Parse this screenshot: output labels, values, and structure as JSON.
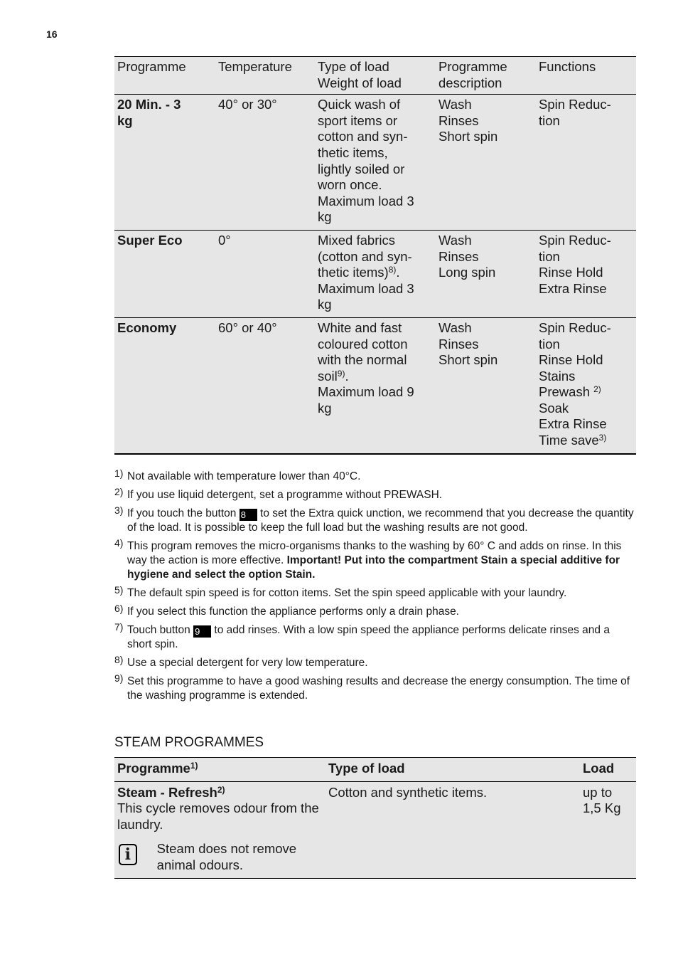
{
  "page_number": "16",
  "programme_table": {
    "headers": [
      "Programme",
      "Temperature",
      "Type of load\nWeight of load",
      "Programme\ndescription",
      "Functions"
    ],
    "rows": [
      {
        "programme": "20 Min. - 3\nkg",
        "temperature": "40° or 30°",
        "load_lines": [
          "Quick wash of",
          "sport items or",
          "cotton and syn-",
          "thetic items,",
          "lightly soiled or",
          "worn once.",
          "Maximum load 3",
          "kg"
        ],
        "description_lines": [
          "Wash",
          "Rinses",
          "Short spin"
        ],
        "functions_lines": [
          "Spin Reduc-",
          "tion"
        ]
      },
      {
        "programme": "Super Eco",
        "temperature": "0°",
        "load_lines": [
          "Mixed fabrics",
          "(cotton and syn-",
          "thetic items)",
          "Maximum load 3",
          "kg"
        ],
        "load_footnote": "8)",
        "description_lines": [
          "Wash",
          "Rinses",
          "Long spin"
        ],
        "functions_lines": [
          "Spin Reduc-",
          "tion",
          "Rinse Hold",
          "Extra Rinse"
        ]
      },
      {
        "programme": "Economy",
        "temperature": "60° or 40°",
        "load_lines": [
          "White and fast",
          "coloured cotton",
          "with the normal",
          "soil",
          "Maximum load 9",
          "kg"
        ],
        "load_footnote": "9)",
        "description_lines": [
          "Wash",
          "Rinses",
          "Short spin"
        ],
        "functions_lines": [
          "Spin Reduc-",
          "tion",
          "Rinse Hold",
          "Stains",
          "Prewash ",
          "Soak",
          "Extra Rinse",
          "Time save"
        ],
        "functions_footnotes": {
          "prewash": "2)",
          "time_save": "3)"
        }
      }
    ]
  },
  "footnotes": [
    {
      "num": "1)",
      "text": "Not available with temperature lower than 40°C."
    },
    {
      "num": "2)",
      "text": "If you use liquid detergent, set a programme without PREWASH."
    },
    {
      "num": "3)",
      "pre": "If you touch the button ",
      "button": "8",
      "post": " to set the Extra quick unction, we recommend that you decrease the quantity of the load. It is possible to keep the full load but the washing results are not good."
    },
    {
      "num": "4)",
      "text": "This program removes the micro-organisms thanks to the washing by 60° C and adds on rinse. In this way the action is more effective. ",
      "bold": "Important! Put into the compartment Stain a special additive for hygiene and select the option Stain."
    },
    {
      "num": "5)",
      "text": "The default spin speed is for cotton items. Set the spin speed applicable with your laundry."
    },
    {
      "num": "6)",
      "text": "If you select this function the appliance performs only a drain phase."
    },
    {
      "num": "7)",
      "pre": "Touch button ",
      "button": "9",
      "post": " to add rinses. With a low spin speed the appliance performs delicate rinses and a short spin."
    },
    {
      "num": "8)",
      "text": "Use a special detergent for very low temperature."
    },
    {
      "num": "9)",
      "text": "Set this programme to have a good washing results and decrease the energy consumption. The time of the washing programme is extended."
    }
  ],
  "steam": {
    "title": "STEAM PROGRAMMES",
    "headers": {
      "programme": "Programme",
      "programme_footnote": "1)",
      "type": "Type of load",
      "load": "Load"
    },
    "row": {
      "name": "Steam - Refresh",
      "name_footnote": "2)",
      "description": "This cycle removes odour from the laundry.",
      "note": "Steam does not remove animal odours.",
      "note_icon": "info-icon",
      "type": "Cotton and synthetic items.",
      "load": "up to\n1,5 Kg"
    }
  }
}
